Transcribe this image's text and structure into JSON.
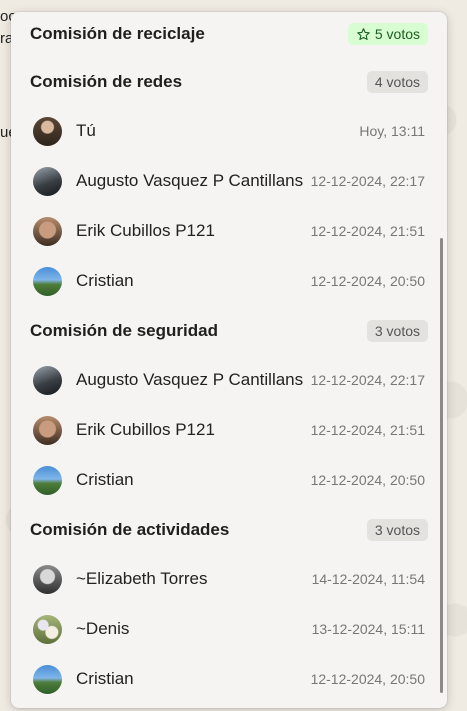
{
  "background": {
    "text_lines": [
      "oc",
      "ra",
      "",
      "",
      "",
      "ue"
    ]
  },
  "sections": [
    {
      "title": "Comisión de reciclaje",
      "votes": "5 votos",
      "highlighted": true,
      "voters": []
    },
    {
      "title": "Comisión de redes",
      "votes": "4 votos",
      "highlighted": false,
      "voters": [
        {
          "name": "Tú",
          "time": "Hoy, 13:11",
          "avatar": "av-you"
        },
        {
          "name": "Augusto Vasquez P Cantillans",
          "time": "12-12-2024, 22:17",
          "avatar": "av-augusto"
        },
        {
          "name": "Erik Cubillos P121",
          "time": "12-12-2024, 21:51",
          "avatar": "av-erik"
        },
        {
          "name": "Cristian",
          "time": "12-12-2024, 20:50",
          "avatar": "av-cristian"
        }
      ]
    },
    {
      "title": "Comisión de seguridad",
      "votes": "3 votos",
      "highlighted": false,
      "voters": [
        {
          "name": "Augusto Vasquez P Cantillans",
          "time": "12-12-2024, 22:17",
          "avatar": "av-augusto"
        },
        {
          "name": "Erik Cubillos P121",
          "time": "12-12-2024, 21:51",
          "avatar": "av-erik"
        },
        {
          "name": "Cristian",
          "time": "12-12-2024, 20:50",
          "avatar": "av-cristian"
        }
      ]
    },
    {
      "title": "Comisión de actividades",
      "votes": "3 votos",
      "highlighted": false,
      "voters": [
        {
          "name": "~Elizabeth Torres",
          "time": "14-12-2024, 11:54",
          "avatar": "av-eliz"
        },
        {
          "name": "~Denis",
          "time": "13-12-2024, 15:11",
          "avatar": "av-denis"
        },
        {
          "name": "Cristian",
          "time": "12-12-2024, 20:50",
          "avatar": "av-cristian"
        }
      ]
    }
  ],
  "icons": {
    "star": "star-icon"
  },
  "colors": {
    "panel_bg": "#f5f4f2",
    "highlight_badge_bg": "#d9fdd3",
    "highlight_badge_fg": "#1b5e20",
    "badge_bg": "#e4e2df"
  }
}
